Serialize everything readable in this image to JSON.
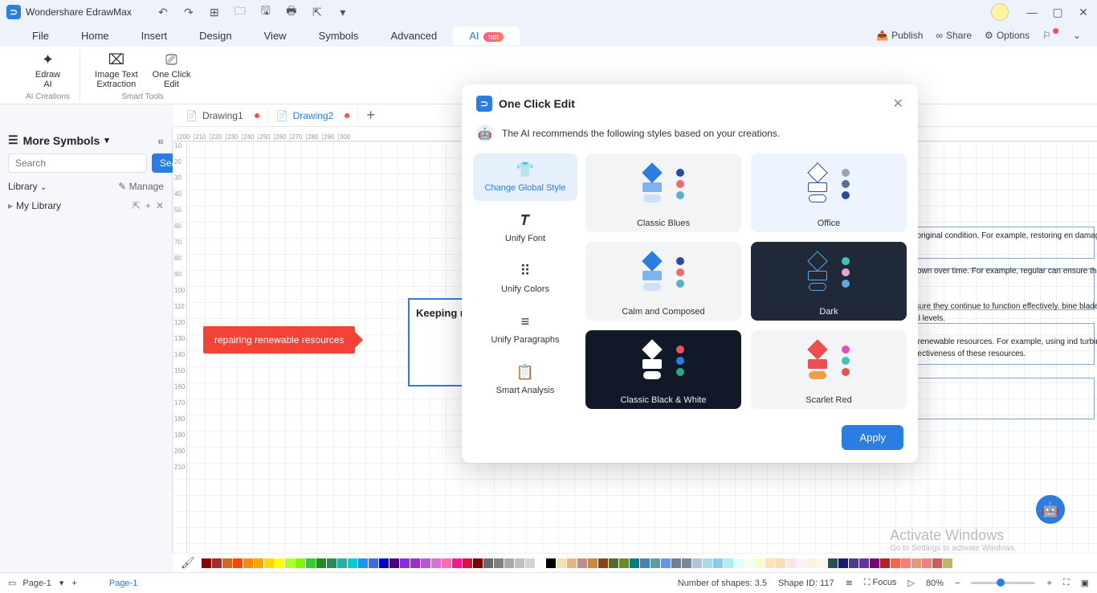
{
  "titlebar": {
    "app_name": "Wondershare EdrawMax"
  },
  "menu": {
    "file": "File",
    "home": "Home",
    "insert": "Insert",
    "design": "Design",
    "view": "View",
    "symbols": "Symbols",
    "advanced": "Advanced",
    "ai": "AI",
    "hot": "hot",
    "publish": "Publish",
    "share": "Share",
    "options": "Options"
  },
  "ribbon": {
    "edraw_ai": "Edraw\nAI",
    "img_text": "Image Text\nExtraction",
    "one_click": "One Click\nEdit",
    "group1": "AI Creations",
    "group2": "Smart Tools"
  },
  "sidebar": {
    "more_symbols": "More Symbols",
    "search_ph": "Search",
    "search_btn": "Search",
    "library": "Library",
    "manage": "Manage",
    "my_library": "My Library"
  },
  "tabs": {
    "d1": "Drawing1",
    "d2": "Drawing2"
  },
  "canvas": {
    "callout": "repairing renewable resources",
    "textbox": "Keeping require aime perform",
    "bg_paragraphs": [
      "aged or degraded renewable resources to original condition. For example, restoring en damaged by human activities.",
      "e activities can help prevent renewable g down over time. For example, regular can ensure that they continue to generate rgy efficiently.",
      "ay be necessary to replace worn-out or ensure they continue to function effectively. bine blades or solar panels can help keep ing at optimal levels.",
      "ative technologies and methods can help f renewable resources. For example, using ind turbine performance or developing new nce the effectiveness of these resources."
    ]
  },
  "dialog": {
    "title": "One Click Edit",
    "subtitle": "The AI recommends the following styles based on your creations.",
    "left": {
      "change_style": "Change Global Style",
      "unify_font": "Unify Font",
      "unify_colors": "Unify Colors",
      "unify_para": "Unify Paragraphs",
      "smart_analysis": "Smart Analysis"
    },
    "styles": {
      "classic_blues": "Classic Blues",
      "office": "Office",
      "calm": "Calm and Composed",
      "dark": "Dark",
      "cbw": "Classic Black & White",
      "scarlet": "Scarlet Red"
    },
    "apply": "Apply"
  },
  "status": {
    "page1": "Page-1",
    "page1b": "Page-1",
    "shapes": "Number of shapes: 3.5",
    "shape_id": "Shape ID: 117",
    "focus": "Focus",
    "zoom": "80%"
  },
  "watermark": {
    "l1": "Activate Windows",
    "l2": "Go to Settings to activate Windows."
  },
  "ruler_h": [
    "200",
    "210",
    "220",
    "230",
    "240",
    "250",
    "260",
    "270",
    "280",
    "290",
    "300"
  ],
  "ruler_v": [
    "10",
    "20",
    "30",
    "40",
    "50",
    "60",
    "70",
    "80",
    "90",
    "100",
    "110",
    "120",
    "130",
    "140",
    "150",
    "160",
    "170",
    "180",
    "190",
    "200",
    "210"
  ],
  "colors": [
    "#8b0000",
    "#a52a2a",
    "#d2691e",
    "#ff4500",
    "#ff8c00",
    "#ffa500",
    "#ffd700",
    "#ffff00",
    "#adff2f",
    "#7cfc00",
    "#32cd32",
    "#228b22",
    "#2e8b57",
    "#20b2aa",
    "#00ced1",
    "#1e90ff",
    "#4169e1",
    "#0000cd",
    "#4b0082",
    "#8a2be2",
    "#9932cc",
    "#ba55d3",
    "#da70d6",
    "#ff69b4",
    "#ff1493",
    "#dc143c",
    "#800000",
    "#696969",
    "#808080",
    "#a9a9a9",
    "#c0c0c0",
    "#d3d3d3",
    "#ffffff",
    "#000000",
    "#f5deb3",
    "#deb887",
    "#bc8f8f",
    "#cd853f",
    "#8b4513",
    "#556b2f",
    "#6b8e23",
    "#008080",
    "#4682b4",
    "#5f9ea0",
    "#6495ed",
    "#708090",
    "#778899",
    "#b0c4de",
    "#add8e6",
    "#87ceeb",
    "#afeeee",
    "#e0ffff",
    "#f0fff0",
    "#fafad2",
    "#ffe4b5",
    "#ffdab9",
    "#ffe4e1",
    "#fff0f5",
    "#f5f5dc",
    "#fdf5e6",
    "#2f4f4f",
    "#191970",
    "#483d8b",
    "#663399",
    "#800080",
    "#b22222",
    "#ff6347",
    "#fa8072",
    "#e9967a",
    "#f08080",
    "#cd5c5c",
    "#bdb76b"
  ]
}
